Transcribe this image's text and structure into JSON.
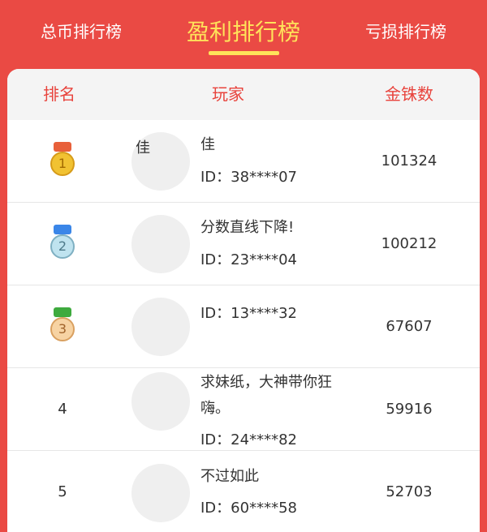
{
  "tabs": [
    {
      "label": "总币排行榜"
    },
    {
      "label": "盈利排行榜"
    },
    {
      "label": "亏损排行榜"
    }
  ],
  "header": {
    "rank": "排名",
    "player": "玩家",
    "coins": "金铢数"
  },
  "rows": [
    {
      "rank": "1",
      "avatar_text": "佳",
      "name": "佳",
      "id": "ID：38****07",
      "coins": "101324"
    },
    {
      "rank": "2",
      "avatar_text": "",
      "name": "分数直线下降!",
      "id": "ID：23****04",
      "coins": "100212"
    },
    {
      "rank": "3",
      "avatar_text": "",
      "name": "",
      "id": "ID：13****32",
      "coins": "67607"
    },
    {
      "rank": "4",
      "avatar_text": "",
      "name_line1": "求妹纸，大神带你狂",
      "name_line2": "嗨。",
      "id": "ID：24****82",
      "coins": "59916"
    },
    {
      "rank": "5",
      "avatar_text": "",
      "name": "不过如此",
      "id": "ID：60****58",
      "coins": "52703"
    }
  ],
  "colors": {
    "background": "#ea4a44",
    "active_tab": "#ffe35a",
    "header_text": "#e8433c",
    "medal_gold": "#f1c232",
    "medal_silver": "#bfe3ef",
    "medal_bronze": "#f7d3a3"
  },
  "icons": [
    "medal-gold-icon",
    "medal-silver-icon",
    "medal-bronze-icon"
  ]
}
